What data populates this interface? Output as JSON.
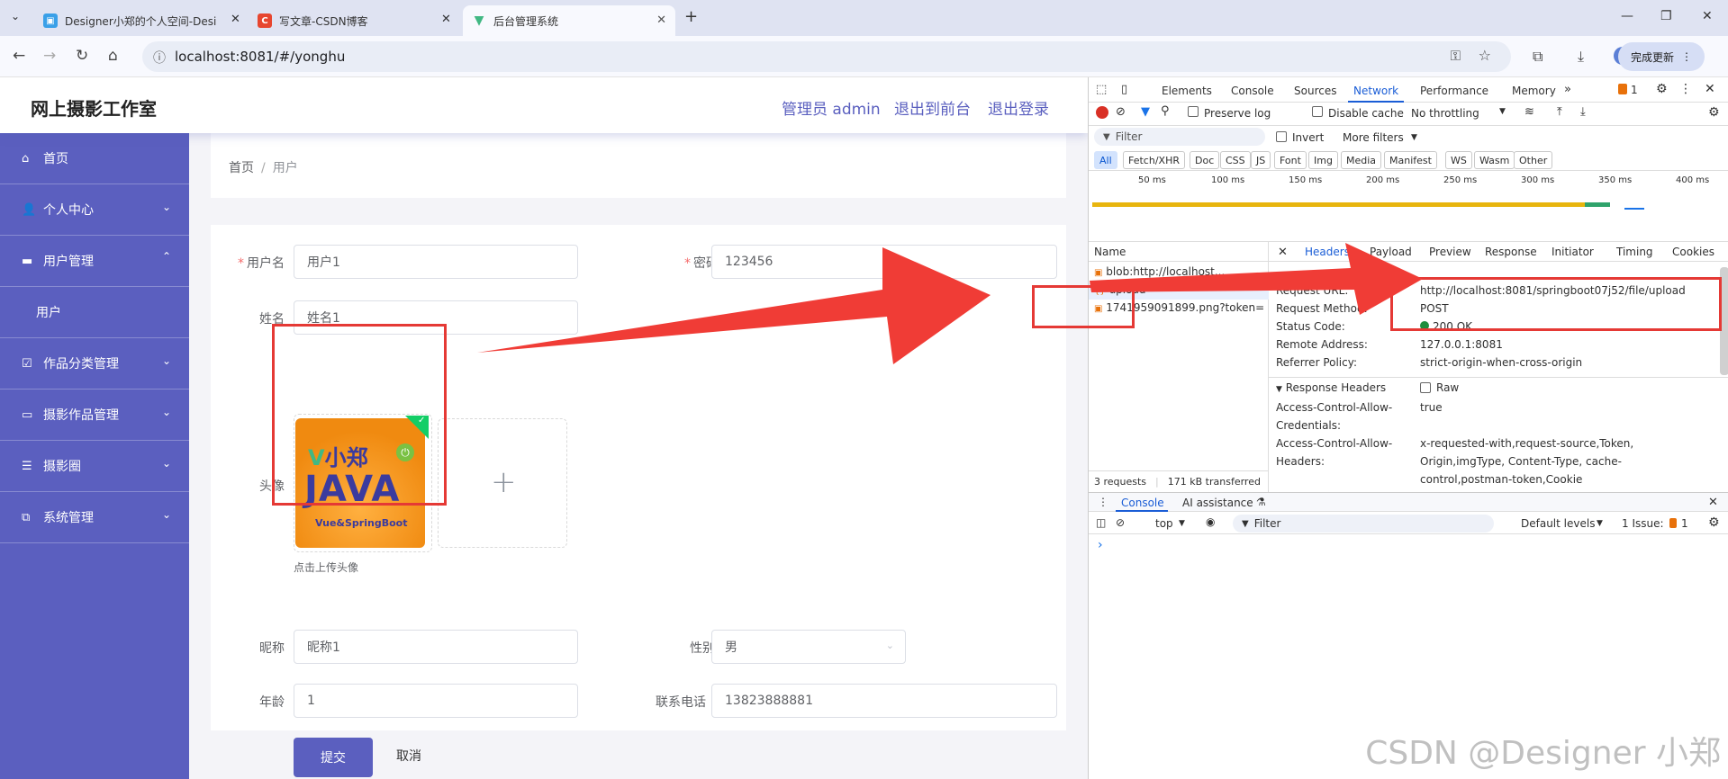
{
  "browser": {
    "tabs": [
      {
        "title": "Designer小郑的个人空间-Desi"
      },
      {
        "title": "写文章-CSDN博客"
      },
      {
        "title": "后台管理系统"
      }
    ],
    "new_tab": "+",
    "url": "localhost:8081/#/yonghu",
    "update_button": "完成更新"
  },
  "app": {
    "brand": "网上摄影工作室",
    "header_links": [
      "管理员 admin",
      "退出到前台",
      "退出登录"
    ],
    "sidebar": [
      {
        "label": "首页",
        "icon": "home-icon"
      },
      {
        "label": "个人中心",
        "icon": "user-icon",
        "chevron": "down"
      },
      {
        "label": "用户管理",
        "icon": "chat-icon",
        "chevron": "up"
      },
      {
        "label": "用户",
        "sub": true
      },
      {
        "label": "作品分类管理",
        "icon": "check-square-icon",
        "chevron": "down"
      },
      {
        "label": "摄影作品管理",
        "icon": "monitor-icon",
        "chevron": "down"
      },
      {
        "label": "摄影圈",
        "icon": "list-icon",
        "chevron": "down"
      },
      {
        "label": "系统管理",
        "icon": "copy-icon",
        "chevron": "down"
      }
    ],
    "breadcrumb": [
      "首页",
      "用户"
    ],
    "form": {
      "username": {
        "label": "用户名",
        "value": "用户1"
      },
      "password": {
        "label": "密码",
        "value": "123456"
      },
      "name": {
        "label": "姓名",
        "value": "姓名1"
      },
      "avatar": {
        "label": "头像",
        "hint": "点击上传头像",
        "img_line1": "小郑",
        "img_line2": "JAVA",
        "img_line3": "Vue&SpringBoot"
      },
      "nickname": {
        "label": "昵称",
        "value": "昵称1"
      },
      "gender": {
        "label": "性别",
        "value": "男"
      },
      "age": {
        "label": "年龄",
        "value": "1"
      },
      "phone": {
        "label": "联系电话",
        "value": "13823888881"
      },
      "submit": "提交",
      "cancel": "取消"
    }
  },
  "devtools": {
    "tabs": [
      "Elements",
      "Console",
      "Sources",
      "Network",
      "Performance",
      "Memory"
    ],
    "issues_count": "1",
    "preserve_log": "Preserve log",
    "disable_cache": "Disable cache",
    "throttling": "No throttling",
    "filter_placeholder": "Filter",
    "invert": "Invert",
    "more_filters": "More filters",
    "filter_types": [
      "All",
      "Fetch/XHR",
      "Doc",
      "CSS",
      "JS",
      "Font",
      "Img",
      "Media",
      "Manifest",
      "WS",
      "Wasm",
      "Other"
    ],
    "timeline_ticks": [
      "50 ms",
      "100 ms",
      "150 ms",
      "200 ms",
      "250 ms",
      "300 ms",
      "350 ms",
      "400 ms"
    ],
    "name_header": "Name",
    "requests": [
      "blob:http://localhost...",
      "upload",
      "1741959091899.png?token="
    ],
    "detail_tabs": [
      "Headers",
      "Payload",
      "Preview",
      "Response",
      "Initiator",
      "Timing",
      "Cookies"
    ],
    "general": [
      {
        "key": "Request URL:",
        "value": "http://localhost:8081/springboot07j52/file/upload"
      },
      {
        "key": "Request Method:",
        "value": "POST"
      },
      {
        "key": "Status Code:",
        "value": "200 OK"
      },
      {
        "key": "Remote Address:",
        "value": "127.0.0.1:8081"
      },
      {
        "key": "Referrer Policy:",
        "value": "strict-origin-when-cross-origin"
      }
    ],
    "response_headers_title": "Response Headers",
    "raw_label": "Raw",
    "response_headers": [
      {
        "key": "Access-Control-Allow-Credentials:",
        "value": "true"
      },
      {
        "key": "Access-Control-Allow-Headers:",
        "value": "x-requested-with,request-source,Token, Origin,imgType, Content-Type, cache-control,postman-token,Cookie"
      }
    ],
    "summary": "3 requests",
    "transferred": "171 kB transferred",
    "drawer_tabs": [
      "Console",
      "AI assistance"
    ],
    "console_context": "top",
    "console_filter": "Filter",
    "levels": "Default levels",
    "issues_label": "1 Issue:",
    "issues_num": "1",
    "prompt": "›"
  },
  "watermark": "CSDN @Designer 小郑",
  "colors": {
    "sidebar": "#5b5fbf",
    "accent": "#1a5dd6",
    "annotation": "#e53935"
  }
}
